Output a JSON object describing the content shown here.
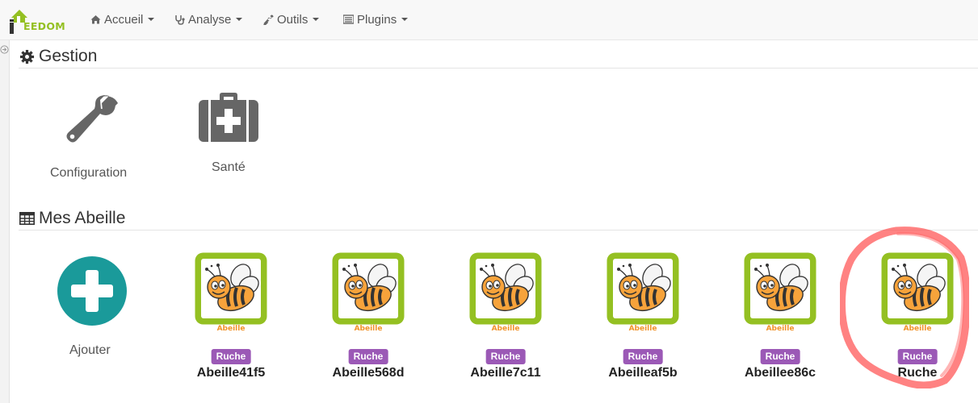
{
  "app": {
    "logo_text": "EEDOM"
  },
  "nav": {
    "items": [
      {
        "label": "Accueil",
        "icon": "home-icon"
      },
      {
        "label": "Analyse",
        "icon": "stethoscope-icon"
      },
      {
        "label": "Outils",
        "icon": "wrench-icon"
      },
      {
        "label": "Plugins",
        "icon": "list-icon"
      }
    ]
  },
  "gestion": {
    "title": "Gestion",
    "items": [
      {
        "label": "Configuration",
        "icon": "wrench-icon"
      },
      {
        "label": "Santé",
        "icon": "medkit-icon"
      }
    ]
  },
  "equipments": {
    "title": "Mes Abeille",
    "add_label": "Ajouter",
    "icon_label": "Abeille",
    "items": [
      {
        "badge": "Ruche",
        "name": "Abeille41f5"
      },
      {
        "badge": "Ruche",
        "name": "Abeille568d"
      },
      {
        "badge": "Ruche",
        "name": "Abeille7c11"
      },
      {
        "badge": "Ruche",
        "name": "Abeilleaf5b"
      },
      {
        "badge": "Ruche",
        "name": "Abeillee86c"
      },
      {
        "badge": "Ruche",
        "name": "Ruche"
      }
    ]
  },
  "colors": {
    "badge": "#9b59b6",
    "add_button": "#1a9a9a",
    "icon_frame": "#94c022",
    "highlight": "#ff4d4d",
    "logo_green": "#94c022"
  }
}
